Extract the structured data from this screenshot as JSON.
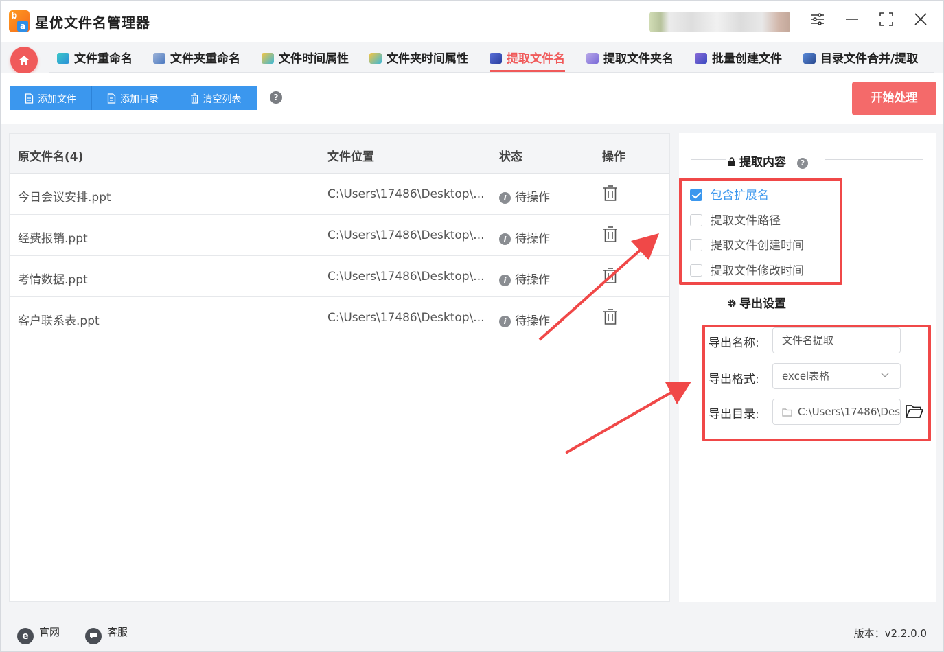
{
  "app": {
    "title": "星优文件名管理器"
  },
  "tabs": [
    {
      "label": "文件重命名",
      "icon": "file-rename-icon",
      "active": false
    },
    {
      "label": "文件夹重命名",
      "icon": "folder-rename-icon",
      "active": false
    },
    {
      "label": "文件时间属性",
      "icon": "file-time-icon",
      "active": false
    },
    {
      "label": "文件夹时间属性",
      "icon": "folder-time-icon",
      "active": false
    },
    {
      "label": "提取文件名",
      "icon": "extract-filename-icon",
      "active": true
    },
    {
      "label": "提取文件夹名",
      "icon": "extract-foldername-icon",
      "active": false
    },
    {
      "label": "批量创建文件",
      "icon": "batch-create-icon",
      "active": false
    },
    {
      "label": "目录文件合并/提取",
      "icon": "merge-extract-icon",
      "active": false
    }
  ],
  "toolbar": {
    "add_file": "添加文件",
    "add_dir": "添加目录",
    "clear_list": "清空列表",
    "help": "?",
    "start": "开始处理"
  },
  "table": {
    "headers": {
      "name": "原文件名(4)",
      "location": "文件位置",
      "status": "状态",
      "action": "操作"
    },
    "rows": [
      {
        "name": "今日会议安排.ppt",
        "location": "C:\\Users\\17486\\Desktop\\...",
        "status": "待操作"
      },
      {
        "name": "经费报销.ppt",
        "location": "C:\\Users\\17486\\Desktop\\...",
        "status": "待操作"
      },
      {
        "name": "考情数据.ppt",
        "location": "C:\\Users\\17486\\Desktop\\...",
        "status": "待操作"
      },
      {
        "name": "客户联系表.ppt",
        "location": "C:\\Users\\17486\\Desktop\\...",
        "status": "待操作"
      }
    ]
  },
  "extract": {
    "title": "提取内容",
    "options": [
      {
        "label": "包含扩展名",
        "checked": true
      },
      {
        "label": "提取文件路径",
        "checked": false
      },
      {
        "label": "提取文件创建时间",
        "checked": false
      },
      {
        "label": "提取文件修改时间",
        "checked": false
      }
    ]
  },
  "export": {
    "title": "导出设置",
    "name_label": "导出名称:",
    "name_value": "文件名提取",
    "format_label": "导出格式:",
    "format_value": "excel表格",
    "dir_label": "导出目录:",
    "dir_value": "C:\\Users\\17486\\Des"
  },
  "footer": {
    "website": "官网",
    "support": "客服",
    "version": "版本：v2.2.0.0"
  },
  "colors": {
    "accent": "#f05a5a",
    "primary": "#3b97ee",
    "annotation": "#f04848"
  }
}
